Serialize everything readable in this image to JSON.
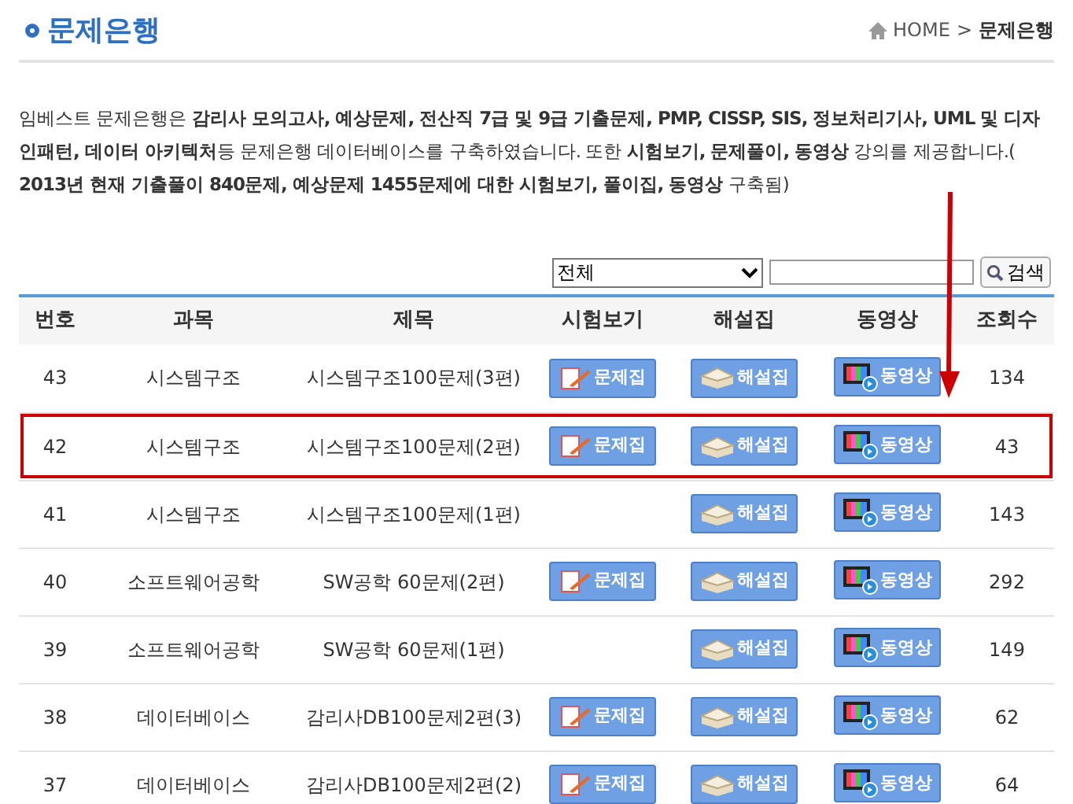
{
  "page_title": "문제은행",
  "breadcrumb": [
    "HOME",
    ">",
    "문제은행"
  ],
  "intro": "임베스트 문제은행은 **감리사 모의고사, 예상문제, 전산직 7급 및 9급 기출문제, PMP, CISSP, SIS, 정보처리기사, UML 및 디자인패턴, 데이터 아키텍처**등 문제은행 데이터베이스를 구축하였습니다. 또한 **시험보기, 문제풀이, 동영상** 강의를 제공합니다.( **2013년 현재 기출풀이 840문제, 예상문제 1455문제에 대한 시험보기, 풀이집, 동영상** 구축됨)",
  "search": {
    "category": "전체",
    "button": "검색"
  },
  "table": {
    "columns": [
      "번호",
      "과목",
      "제목",
      "시험보기",
      "해설집",
      "동영상",
      "조회수"
    ],
    "rows": [
      {
        "no": "43",
        "subject": "시스템구조",
        "title": "시스템구조100문제(3편)",
        "exam": "문제집",
        "solution": "해설집",
        "video": "동영상",
        "views": "134",
        "selected": false
      },
      {
        "no": "42",
        "subject": "시스템구조",
        "title": "시스템구조100문제(2편)",
        "exam": "문제집",
        "solution": "해설집",
        "video": "동영상",
        "views": "43",
        "selected": true
      },
      {
        "no": "41",
        "subject": "시스템구조",
        "title": "시스템구조100문제(1편)",
        "solution": "해설집",
        "video": "동영상",
        "views": "143",
        "selected": false
      },
      {
        "no": "40",
        "subject": "소프트웨어공학",
        "title": "SW공학 60문제(2편)",
        "exam": "문제집",
        "solution": "해설집",
        "video": "동영상",
        "views": "292",
        "selected": false
      },
      {
        "no": "39",
        "subject": "소프트웨어공학",
        "title": "SW공학 60문제(1편)",
        "solution": "해설집",
        "video": "동영상",
        "views": "149",
        "selected": false
      },
      {
        "no": "38",
        "subject": "데이터베이스",
        "title": "감리사DB100문제2편(3)",
        "exam": "문제집",
        "solution": "해설집",
        "video": "동영상",
        "views": "62",
        "selected": false
      },
      {
        "no": "37",
        "subject": "데이터베이스",
        "title": "감리사DB100문제2편(2)",
        "exam": "문제집",
        "solution": "해설집",
        "video": "동영상",
        "views": "64",
        "selected": false
      }
    ]
  }
}
